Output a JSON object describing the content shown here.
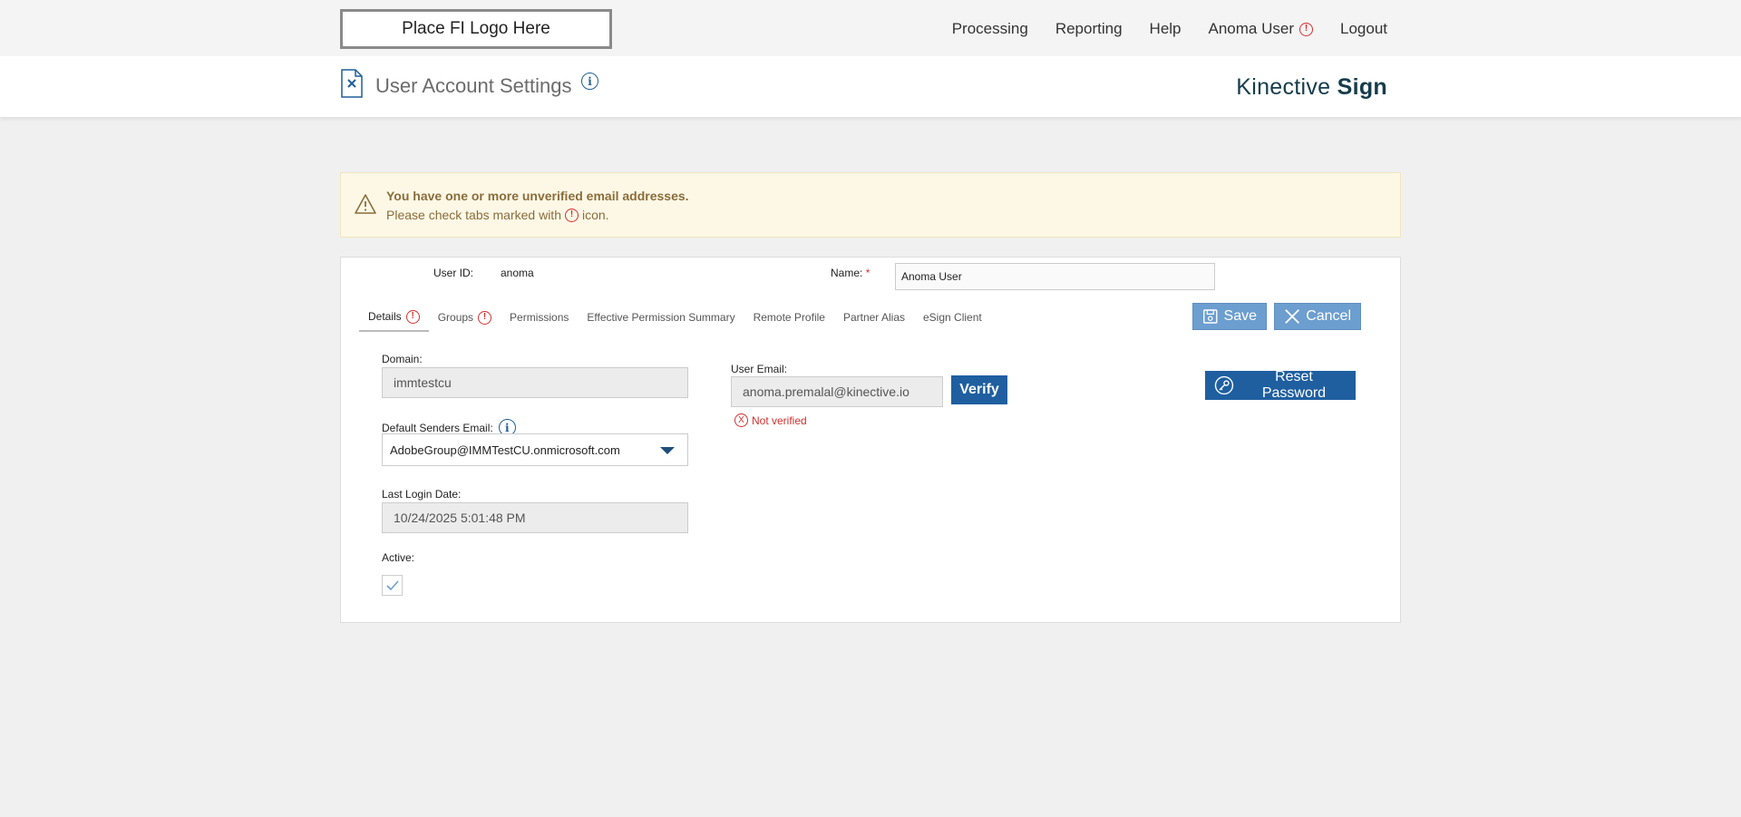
{
  "topbar": {
    "logo_text": "Place FI Logo Here",
    "nav": {
      "processing": "Processing",
      "reporting": "Reporting",
      "help": "Help",
      "user": "Anoma User",
      "logout": "Logout"
    }
  },
  "header": {
    "title": "User Account Settings",
    "brand_light": "Kinective ",
    "brand_bold": "Sign"
  },
  "warning": {
    "line1": "You have one or more unverified email addresses.",
    "line2_prefix": "Please check tabs marked with",
    "line2_suffix": "icon."
  },
  "form": {
    "user_id_label": "User ID:",
    "user_id_value": "anoma",
    "name_label": "Name:",
    "required_mark": "*",
    "name_value": "Anoma User",
    "tabs": [
      "Details",
      "Groups",
      "Permissions",
      "Effective Permission Summary",
      "Remote Profile",
      "Partner Alias",
      "eSign Client"
    ],
    "save_label": "Save",
    "cancel_label": "Cancel",
    "domain_label": "Domain:",
    "domain_value": "immtestcu",
    "default_senders_label": "Default Senders Email:",
    "default_senders_value": "AdobeGroup@IMMTestCU.onmicrosoft.com",
    "last_login_label": "Last Login Date:",
    "last_login_value": "10/24/2025 5:01:48 PM",
    "active_label": "Active:",
    "active_checked": true,
    "user_email_label": "User Email:",
    "user_email_value": "anoma.premalal@kinective.io",
    "verify_label": "Verify",
    "not_verified_text": "Not verified",
    "reset_password_label": "Reset Password"
  },
  "colors": {
    "primary_blue": "#1f5fa0",
    "light_blue": "#6c9ecf",
    "error_red": "#d32f2f",
    "warning_bg": "#fdf8e6",
    "brand_dark": "#163c4a"
  }
}
